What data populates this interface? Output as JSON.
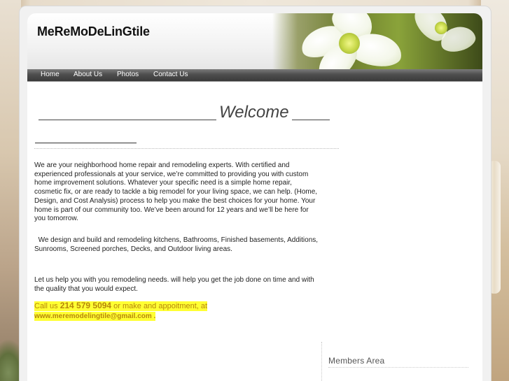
{
  "site": {
    "title": "MeReMoDeLinGtile"
  },
  "nav": {
    "items": [
      {
        "label": "Home"
      },
      {
        "label": "About Us"
      },
      {
        "label": "Photos"
      },
      {
        "label": "Contact Us"
      }
    ]
  },
  "main": {
    "heading": "Welcome",
    "paragraph1": "We are your neighborhood home repair and remodeling experts. With certified and experienced professionals at your service, we’re committed to providing you with custom home improvement solutions. Whatever your specific need is a simple home repair, cosmetic fix, or are ready to tackle a big remodel for your living space, we can help. (Home, Design, and Cost Analysis) process to help you make the best choices for your home. Your home is part of our community too. We’ve been around for 12 years and we’ll be here for you tomorrow.",
    "paragraph2": "  We design and build and remodeling kitchens, Bathrooms, Finished basements, Additions, Sunrooms, Screened porches, Decks, and Outdoor living areas.",
    "paragraph3": "Let us help you with you remodeling needs. will help you get the job done on time and with the quality that you would expect.",
    "cta": {
      "prefix": "Call us ",
      "phone": "214 579 5094",
      "middle": " or make and appoitment, at",
      "email": " www.meremodelingtile@gmail.com ."
    }
  },
  "sidebar": {
    "members_title": "Members Area"
  },
  "colors": {
    "highlight": "#ffff33",
    "cta_text": "#b8860b",
    "nav_bg": "#4e4e4e"
  }
}
